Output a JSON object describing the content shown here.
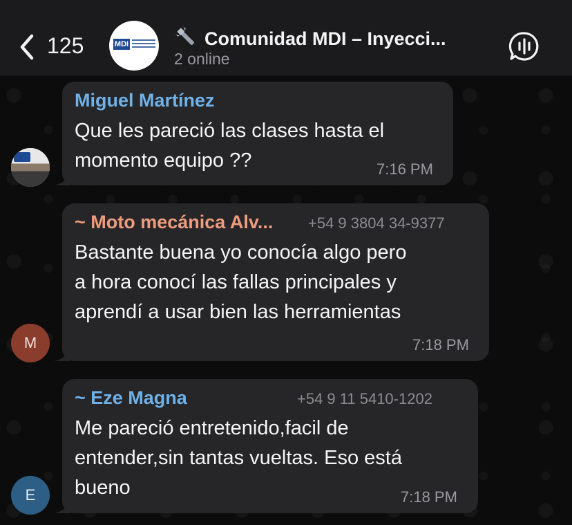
{
  "header": {
    "back_count": "125",
    "title": "Comunidad MDI – Inyecci...",
    "subtitle": "2 online",
    "logo_text": "MDI"
  },
  "messages": [
    {
      "sender": "Miguel Martínez",
      "sender_color": "#6fb1e8",
      "phone": "",
      "lines": [
        "Que les pareció las clases hasta el",
        "momento equipo ??"
      ],
      "time": "7:16 PM",
      "avatar_letter": "",
      "avatar_color": "#d8d8d8"
    },
    {
      "sender": "~ Moto mecánica Alv...",
      "sender_color": "#ef9c7e",
      "phone": "+54 9 3804 34-9377",
      "lines": [
        "Bastante buena yo conocía algo pero",
        "a hora conocí las fallas principales y",
        "aprendí a usar bien las herramientas"
      ],
      "time": "7:18 PM",
      "avatar_letter": "M",
      "avatar_color": "#8a3d2d"
    },
    {
      "sender": "~ Eze Magna",
      "sender_color": "#6fb1e8",
      "phone": "+54 9 11 5410-1202",
      "lines": [
        "Me pareció entretenido,facil de",
        "entender,sin tantas vueltas. Eso está",
        "bueno"
      ],
      "time": "7:18 PM",
      "avatar_letter": "E",
      "avatar_color": "#2d5f86"
    }
  ]
}
